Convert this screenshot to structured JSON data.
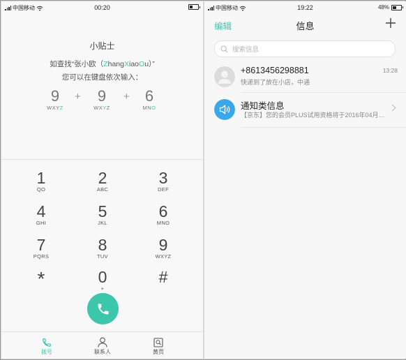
{
  "left": {
    "status": {
      "carrier": "中国移动",
      "time": "00:20"
    },
    "tips": {
      "title": "小贴士",
      "line1_pre": "如查找“张小欧（",
      "line1_seg": [
        {
          "t": "Z",
          "hl": true
        },
        {
          "t": "hang",
          "hl": false
        },
        {
          "t": "X",
          "hl": true
        },
        {
          "t": "iao",
          "hl": false
        },
        {
          "t": "O",
          "hl": true
        },
        {
          "t": "u",
          "hl": false
        }
      ],
      "line1_post": "）”",
      "line2": "您可以在键盘依次输入："
    },
    "example": [
      {
        "digit": "9",
        "letters_pre": "WXY",
        "letters_hl": "Z",
        "letters_post": ""
      },
      {
        "digit": "9",
        "letters_pre": "WX",
        "letters_hl": "Y",
        "letters_post": "Z"
      },
      {
        "digit": "6",
        "letters_pre": "MN",
        "letters_hl": "O",
        "letters_post": ""
      }
    ],
    "example_plus": "+",
    "keypad": [
      {
        "digit": "1",
        "letters": "QO"
      },
      {
        "digit": "2",
        "letters": "ABC"
      },
      {
        "digit": "3",
        "letters": "DEF"
      },
      {
        "digit": "4",
        "letters": "GHI"
      },
      {
        "digit": "5",
        "letters": "JKL"
      },
      {
        "digit": "6",
        "letters": "MNO"
      },
      {
        "digit": "7",
        "letters": "PQRS"
      },
      {
        "digit": "8",
        "letters": "TUV"
      },
      {
        "digit": "9",
        "letters": "WXYZ"
      },
      {
        "digit": "*",
        "letters": ""
      },
      {
        "digit": "0",
        "letters": "+"
      },
      {
        "digit": "#",
        "letters": ""
      }
    ],
    "tabs": {
      "dial": "拨号",
      "contacts": "联系人",
      "yellow_pages": "黄页"
    }
  },
  "right": {
    "status": {
      "carrier": "中国移动",
      "time": "19:22",
      "battery": "48%"
    },
    "nav": {
      "edit": "编辑",
      "title": "信息"
    },
    "search": {
      "placeholder": "搜索信息"
    },
    "messages": [
      {
        "name": "+8613456298881",
        "snippet": "快递到了放在小店，中通",
        "time": "13:28"
      },
      {
        "name": "通知类信息",
        "snippet": "【京东】您的会员PLUS试用资格将于2016年04月…",
        "time": ""
      }
    ]
  },
  "colors": {
    "accent": "#3cc7ad",
    "notify": "#3aa7e8"
  }
}
